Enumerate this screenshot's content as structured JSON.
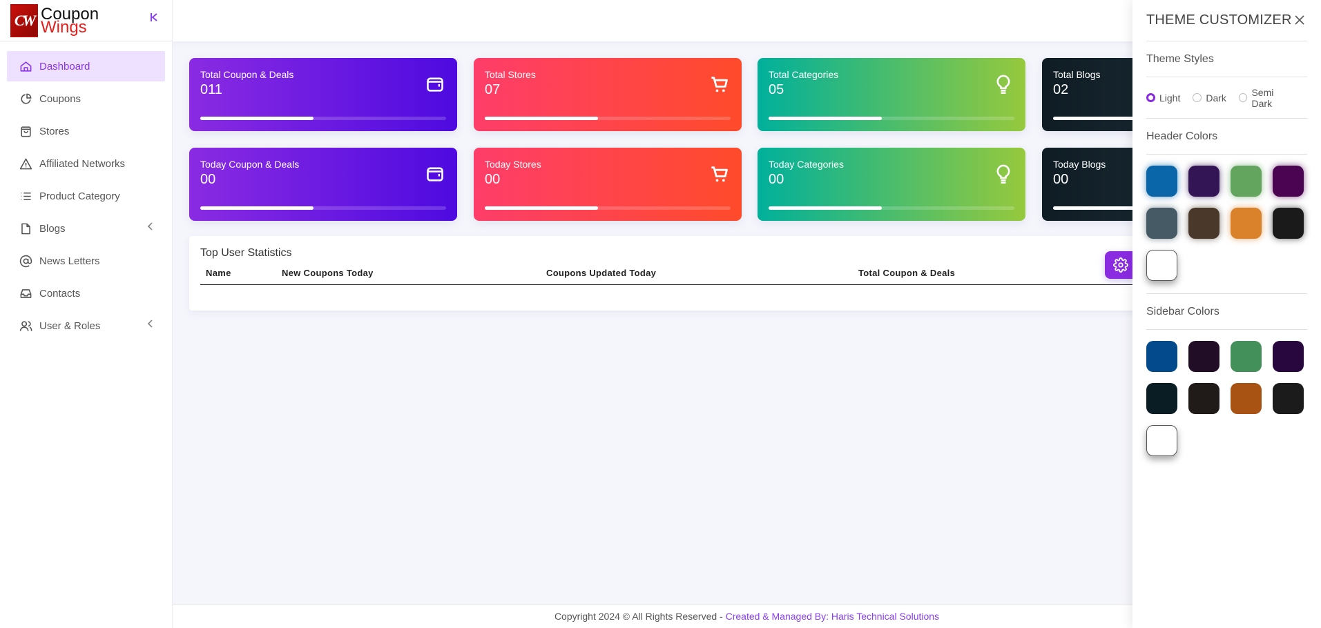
{
  "brand": {
    "logo_mark": "CW",
    "line1": "Coupon",
    "line2": "Wings",
    "collapse_icon": "chevron-double-left-icon"
  },
  "sidebar": {
    "items": [
      {
        "label": "Dashboard",
        "icon": "home-icon",
        "active": true,
        "has_submenu": false
      },
      {
        "label": "Coupons",
        "icon": "pie-chart-icon",
        "active": false,
        "has_submenu": false
      },
      {
        "label": "Stores",
        "icon": "shopping-bag-icon",
        "active": false,
        "has_submenu": false
      },
      {
        "label": "Affiliated Networks",
        "icon": "warning-triangle-icon",
        "active": false,
        "has_submenu": false
      },
      {
        "label": "Product Category",
        "icon": "list-icon",
        "active": false,
        "has_submenu": false
      },
      {
        "label": "Blogs",
        "icon": "file-icon",
        "active": false,
        "has_submenu": true
      },
      {
        "label": "News Letters",
        "icon": "at-sign-icon",
        "active": false,
        "has_submenu": false
      },
      {
        "label": "Contacts",
        "icon": "inbox-icon",
        "active": false,
        "has_submenu": false
      },
      {
        "label": "User & Roles",
        "icon": "users-icon",
        "active": false,
        "has_submenu": true
      }
    ]
  },
  "cards": [
    {
      "label": "Total Coupon & Deals",
      "value": "011",
      "icon": "wallet-icon",
      "theme": "purple",
      "progress_pct": 46
    },
    {
      "label": "Total Stores",
      "value": "07",
      "icon": "cart-icon",
      "theme": "red",
      "progress_pct": 46
    },
    {
      "label": "Total Categories",
      "value": "05",
      "icon": "lightbulb-icon",
      "theme": "green",
      "progress_pct": 46
    },
    {
      "label": "Total Blogs",
      "value": "02",
      "icon": "file-icon",
      "theme": "dark",
      "progress_pct": 46
    },
    {
      "label": "Today Coupon & Deals",
      "value": "00",
      "icon": "wallet-icon",
      "theme": "purple",
      "progress_pct": 46
    },
    {
      "label": "Today Stores",
      "value": "00",
      "icon": "cart-icon",
      "theme": "red",
      "progress_pct": 46
    },
    {
      "label": "Today Categories",
      "value": "00",
      "icon": "lightbulb-icon",
      "theme": "green",
      "progress_pct": 46
    },
    {
      "label": "Today Blogs",
      "value": "00",
      "icon": "file-icon",
      "theme": "dark",
      "progress_pct": 46
    }
  ],
  "stats": {
    "title": "Top User Statistics",
    "columns": [
      "Name",
      "New Coupons Today",
      "Coupons Updated Today",
      "Total Coupon & Deals"
    ],
    "rows": []
  },
  "footer": {
    "copyright": "Copyright 2024 © All Rights Reserved - ",
    "credit": "Created & Managed By: Haris Technical Solutions"
  },
  "customizer": {
    "title": "THEME CUSTOMIZER",
    "theme_styles_label": "Theme Styles",
    "theme_styles": [
      {
        "label": "Light",
        "selected": true
      },
      {
        "label": "Dark",
        "selected": false
      },
      {
        "label": "Semi Dark",
        "selected": false
      }
    ],
    "header_colors_label": "Header Colors",
    "header_colors": [
      "#0a66a8",
      "#331455",
      "#63a55e",
      "#4b0451",
      "#455a64",
      "#4a392b",
      "#d9822b",
      "#1a1a1a",
      "#ffffff"
    ],
    "sidebar_colors_label": "Sidebar Colors",
    "sidebar_colors": [
      "#034a8c",
      "#220d26",
      "#44905a",
      "#28063e",
      "#0a1c24",
      "#201b19",
      "#a85314",
      "#1b1b1b",
      "#ffffff"
    ]
  },
  "accent_color": "#8a2be2"
}
